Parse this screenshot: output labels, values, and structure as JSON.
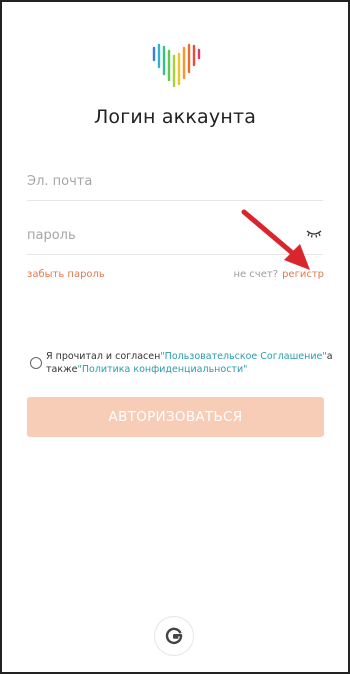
{
  "login": {
    "title": "Логин аккаунта",
    "email_placeholder": "Эл. почта",
    "email_value": "",
    "password_placeholder": "пароль",
    "password_value": "",
    "forgot_password": "забыть пароль",
    "no_account": "не счет?",
    "register": "регистр",
    "submit": "АВТОРИЗОВАТЬСЯ"
  },
  "agreement": {
    "prefix": "Я прочитал и согласен",
    "user_agreement": "\"Пользовательское Соглашение\"",
    "connector": "а также",
    "privacy_policy": "\"Политика конфиденциальности\""
  },
  "icons": {
    "logo": "heart-waveform-logo",
    "password_toggle": "eye-closed-icon",
    "social": "google-icon",
    "annotation": "red-arrow"
  },
  "colors": {
    "accent": "#e07a4f",
    "button_disabled": "#f8cdb8",
    "link": "#2a9dab",
    "annotation": "#d9262c"
  }
}
